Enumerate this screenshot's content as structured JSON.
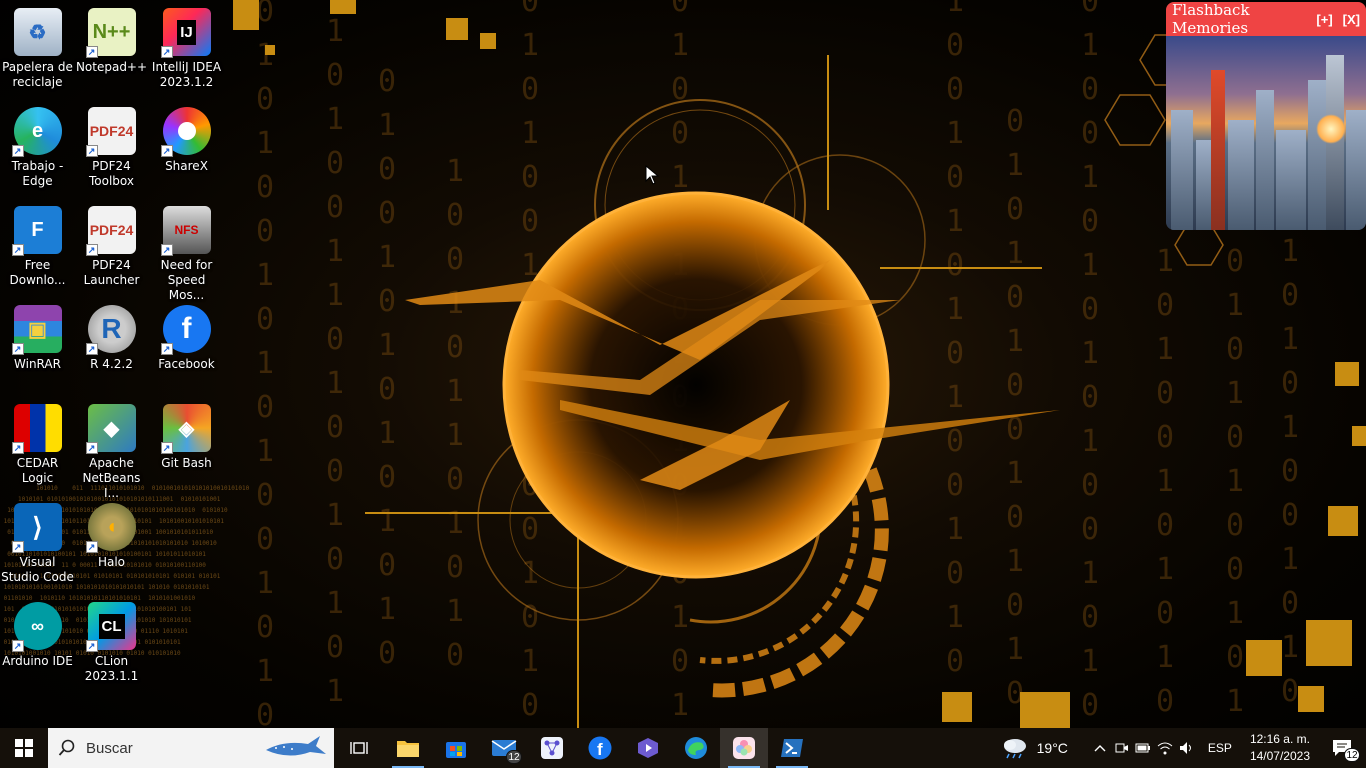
{
  "desktop": {
    "icons": [
      {
        "label": "Papelera de reciclaje"
      },
      {
        "label": "Notepad++"
      },
      {
        "label": "IntelliJ IDEA 2023.1.2"
      },
      {
        "label": "Trabajo - Edge"
      },
      {
        "label": "PDF24 Toolbox"
      },
      {
        "label": "ShareX"
      },
      {
        "label": "Free Downlo..."
      },
      {
        "label": "PDF24 Launcher"
      },
      {
        "label": "Need for Speed Mos..."
      },
      {
        "label": "WinRAR"
      },
      {
        "label": "R 4.2.2"
      },
      {
        "label": "Facebook"
      },
      {
        "label": "CEDAR Logic"
      },
      {
        "label": "Apache NetBeans I..."
      },
      {
        "label": "Git Bash"
      },
      {
        "label": "Visual Studio Code"
      },
      {
        "label": "Halo"
      },
      {
        "label": "Arduino IDE"
      },
      {
        "label": "CLion 2023.1.1"
      }
    ]
  },
  "widget": {
    "title": "Flashback Memories",
    "add_label": "[+]",
    "close_label": "[X]"
  },
  "taskbar": {
    "search_placeholder": "Buscar",
    "mail_badge": "12",
    "weather_temp": "19°C",
    "language": "ESP",
    "time": "12:16 a. m.",
    "date": "14/07/2023",
    "notifications_badge": "12"
  },
  "colors": {
    "accent": "#c88d12",
    "widget_title_bg": "#ef4444",
    "taskbar_bg": "#15100a"
  }
}
